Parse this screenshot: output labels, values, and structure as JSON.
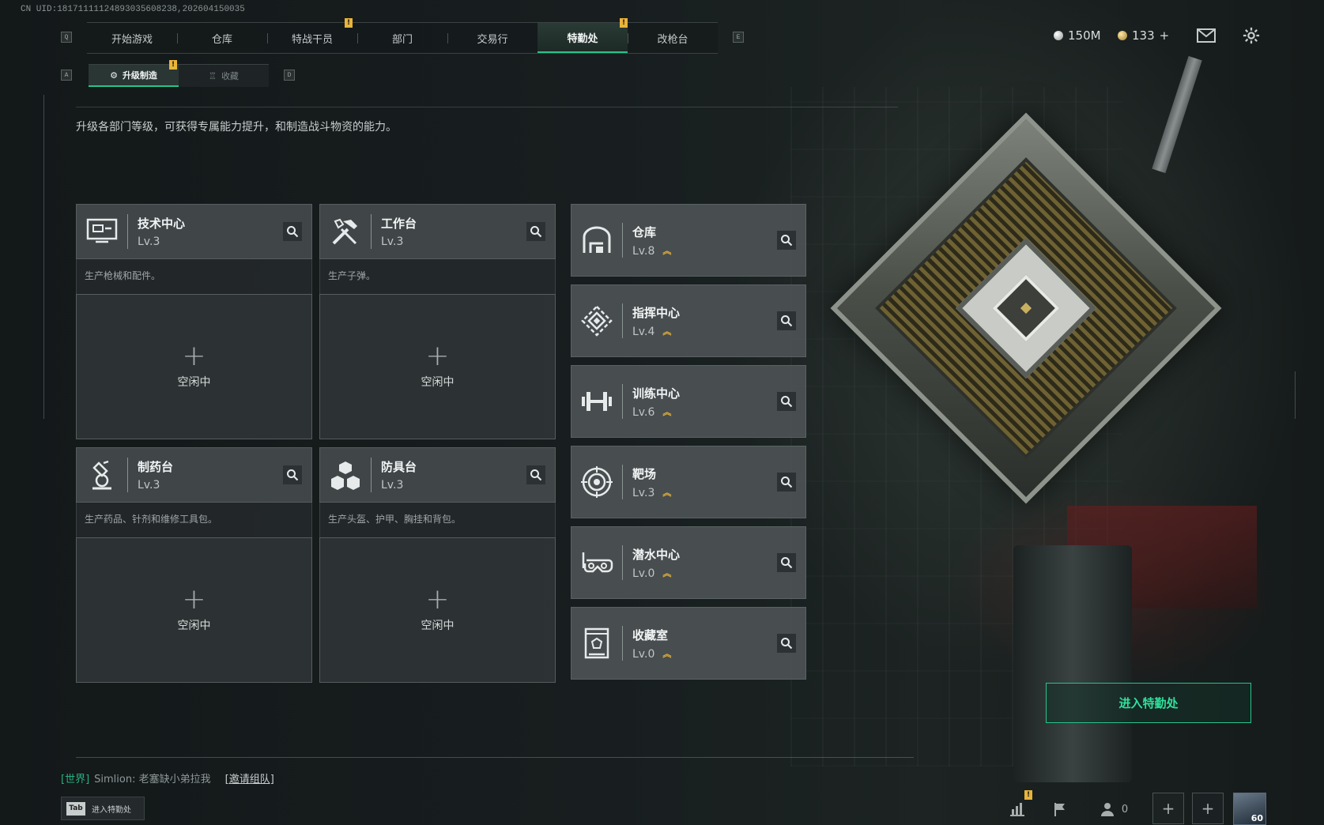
{
  "uid": "CN UID:18171111124893035608238,202604150035",
  "nav": {
    "key_left": "Q",
    "key_right": "E",
    "tabs": [
      {
        "label": "开始游戏"
      },
      {
        "label": "仓库"
      },
      {
        "label": "特战干员",
        "badge": "!"
      },
      {
        "label": "部门"
      },
      {
        "label": "交易行"
      },
      {
        "label": "特勤处",
        "badge": "!",
        "active": true
      },
      {
        "label": "改枪台"
      }
    ]
  },
  "currency": {
    "silver": "150M",
    "gold": "133",
    "gold_add": "+"
  },
  "subtabs": {
    "key_left": "A",
    "key_right": "D",
    "items": [
      {
        "label": "升级制造",
        "badge": "!",
        "active": true
      },
      {
        "label": "收藏"
      }
    ]
  },
  "intro": "升级各部门等级，可获得专属能力提升，和制造战斗物资的能力。",
  "production": [
    {
      "name": "技术中心",
      "level": "Lv.3",
      "desc": "生产枪械和配件。",
      "slot": "空闲中",
      "icon": "tech-center-icon"
    },
    {
      "name": "工作台",
      "level": "Lv.3",
      "desc": "生产子弹。",
      "slot": "空闲中",
      "icon": "workbench-icon"
    },
    {
      "name": "制药台",
      "level": "Lv.3",
      "desc": "生产药品、针剂和维修工具包。",
      "slot": "空闲中",
      "icon": "pharmacy-icon"
    },
    {
      "name": "防具台",
      "level": "Lv.3",
      "desc": "生产头盔、护甲、胸挂和背包。",
      "slot": "空闲中",
      "icon": "armor-bench-icon"
    }
  ],
  "facilities": [
    {
      "name": "仓库",
      "level": "Lv.8",
      "icon": "warehouse-icon"
    },
    {
      "name": "指挥中心",
      "level": "Lv.4",
      "icon": "command-center-icon"
    },
    {
      "name": "训练中心",
      "level": "Lv.6",
      "icon": "training-center-icon"
    },
    {
      "name": "靶场",
      "level": "Lv.3",
      "icon": "shooting-range-icon"
    },
    {
      "name": "潜水中心",
      "level": "Lv.0",
      "icon": "diving-center-icon"
    },
    {
      "name": "收藏室",
      "level": "Lv.0",
      "icon": "collection-room-icon"
    }
  ],
  "enter_button": "进入特勤处",
  "chat": {
    "channel": "[世界]",
    "message": "Simlion: 老塞缺小弟拉我",
    "invite": "[邀请组队]"
  },
  "tab_hint": {
    "key": "Tab",
    "label": "进入特勤处"
  },
  "bottom_bar": {
    "friends_count": "0",
    "avatar_level": "60"
  },
  "colors": {
    "accent_green": "#27c48a",
    "upgrade_gold": "#e8b43a"
  }
}
